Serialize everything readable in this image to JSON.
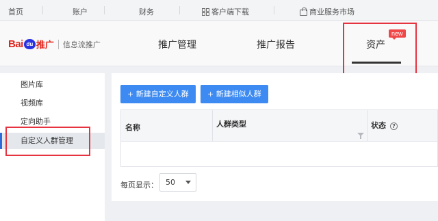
{
  "topbar": {
    "home": "首页",
    "account": "账户",
    "finance": "财务",
    "client_download": "客户端下载",
    "client_download_icon": "grid-icon",
    "market": "商业服务市场",
    "market_icon": "shopping-bag-icon"
  },
  "header": {
    "logo_bai": "Bai",
    "logo_du": "du",
    "logo_tg": "推广",
    "logo_sub": "信息流推广",
    "nav": [
      {
        "label": "推广管理"
      },
      {
        "label": "推广报告"
      },
      {
        "label": "资产",
        "active": true
      }
    ],
    "new_badge": "new"
  },
  "sidebar": {
    "items": [
      {
        "label": "图片库"
      },
      {
        "label": "视频库"
      },
      {
        "label": "定向助手"
      },
      {
        "label": "自定义人群管理",
        "active": true
      }
    ]
  },
  "toolbar": {
    "new_custom": "+ 新建自定义人群",
    "new_similar": "+ 新建相似人群"
  },
  "table": {
    "columns": [
      "名称",
      "人群类型",
      "状态"
    ],
    "rows": []
  },
  "pager": {
    "label": "每页显示：",
    "page_size": "50"
  },
  "colors": {
    "accent": "#3d8bf2",
    "brand_red": "#e1251b",
    "highlight_box": "#e5333f"
  }
}
